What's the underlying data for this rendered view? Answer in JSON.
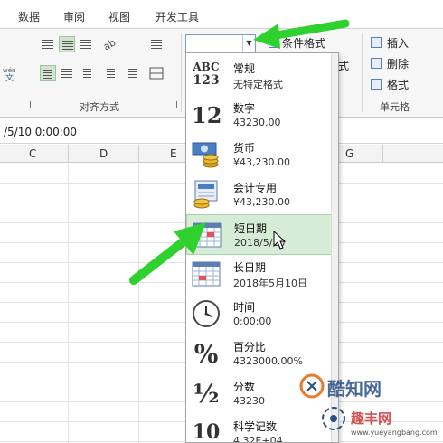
{
  "ribbon_tabs": [
    "数据",
    "审阅",
    "视图",
    "开发工具"
  ],
  "ribbon": {
    "alignment_group_label": "对齐方式",
    "format_combo_value": "",
    "conditional_format_label": "条件格式",
    "table_format_partial": "式",
    "cells": {
      "insert_label": "插入",
      "delete_label": "删除",
      "format_label": "格式",
      "group_label": "单元格"
    }
  },
  "formula_bar": {
    "content": "/5/10  0:00:00"
  },
  "columns": [
    "C",
    "D",
    "E",
    "G"
  ],
  "number_format_menu": {
    "items": [
      {
        "name": "常规",
        "sample": "无特定格式",
        "icon": "abc-123-icon",
        "selected": false
      },
      {
        "name": "数字",
        "sample": "43230.00",
        "icon": "number-12-icon",
        "selected": false
      },
      {
        "name": "货币",
        "sample": "¥43,230.00",
        "icon": "currency-icon",
        "selected": false
      },
      {
        "name": "会计专用",
        "sample": "¥43,230.00",
        "icon": "accounting-icon",
        "selected": false
      },
      {
        "name": "短日期",
        "sample": "2018/5/10",
        "icon": "calendar-icon",
        "selected": true
      },
      {
        "name": "长日期",
        "sample": "2018年5月10日",
        "icon": "calendar-icon",
        "selected": false
      },
      {
        "name": "时间",
        "sample": "0:00:00",
        "icon": "clock-icon",
        "selected": false
      },
      {
        "name": "百分比",
        "sample": "4323000.00%",
        "icon": "percent-icon",
        "selected": false
      },
      {
        "name": "分数",
        "sample": "43230",
        "icon": "fraction-icon",
        "selected": false
      },
      {
        "name": "科学记数",
        "sample": "4.32E+04",
        "icon": "scientific-icon",
        "selected": false
      }
    ]
  },
  "icon_glyphs": {
    "abc": "ABC",
    "n123": "123",
    "n12": "12",
    "percent": "%",
    "half": "½",
    "sci": "10",
    "currency_symbol": "¥"
  },
  "watermark": {
    "brand": "酷知网",
    "site": "趣丰网",
    "url": "www.yueyangbang.com"
  },
  "colors": {
    "selection_bg": "#d6ecd6",
    "arrow_green": "#2fd12f",
    "combo_border": "#7a9cc9"
  }
}
